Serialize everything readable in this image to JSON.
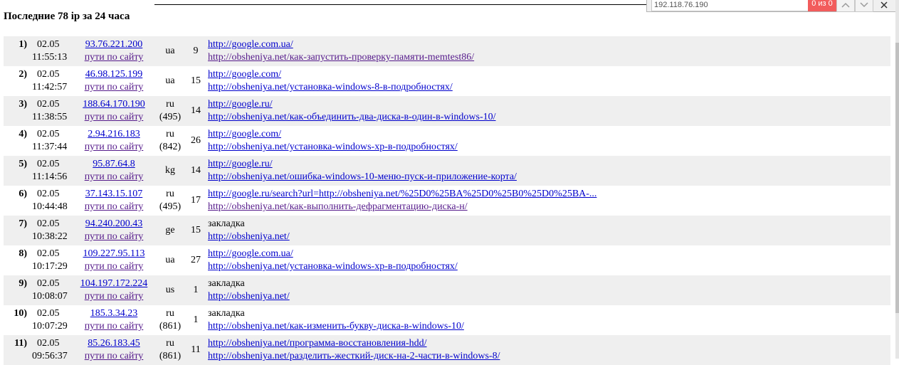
{
  "header": {
    "title": "Последние 78 ip за 24 часа"
  },
  "find_bar": {
    "query": "192.118.76.190",
    "result_count": "0 из 0"
  },
  "rows": [
    {
      "num": "1)",
      "date": "02.05",
      "time": "11:55:13",
      "ip": "93.76.221.200",
      "path_link": "пути по сайту",
      "country": "ua",
      "code": "",
      "count": "9",
      "referrer": "http://google.com.ua/",
      "referrer_is_link": true,
      "page": "http://obsheniya.net/как-запустить-проверку-памяти-memtest86/"
    },
    {
      "num": "2)",
      "date": "02.05",
      "time": "11:42:57",
      "ip": "46.98.125.199",
      "path_link": "пути по сайту",
      "country": "ua",
      "code": "",
      "count": "15",
      "referrer": "http://google.com/",
      "referrer_is_link": true,
      "page": "http://obsheniya.net/установка-windows-8-в-подробностях/"
    },
    {
      "num": "3)",
      "date": "02.05",
      "time": "11:38:55",
      "ip": "188.64.170.190",
      "path_link": "пути по сайту",
      "country": "ru",
      "code": "(495)",
      "count": "14",
      "referrer": "http://google.ru/",
      "referrer_is_link": true,
      "page": "http://obsheniya.net/как-объединить-два-диска-в-один-в-windows-10/"
    },
    {
      "num": "4)",
      "date": "02.05",
      "time": "11:37:44",
      "ip": "2.94.216.183",
      "path_link": "пути по сайту",
      "country": "ru",
      "code": "(842)",
      "count": "26",
      "referrer": "http://google.com/",
      "referrer_is_link": true,
      "page": "http://obsheniya.net/установка-windows-xp-в-подробностях/"
    },
    {
      "num": "5)",
      "date": "02.05",
      "time": "11:14:56",
      "ip": "95.87.64.8",
      "path_link": "пути по сайту",
      "country": "kg",
      "code": "",
      "count": "14",
      "referrer": "http://google.ru/",
      "referrer_is_link": true,
      "page": "http://obsheniya.net/ошибка-windows-10-меню-пуск-и-приложение-корта/"
    },
    {
      "num": "6)",
      "date": "02.05",
      "time": "10:44:48",
      "ip": "37.143.15.107",
      "path_link": "пути по сайту",
      "country": "ru",
      "code": "(495)",
      "count": "17",
      "referrer": "http://google.ru/search?url=http://obsheniya.net/%25D0%25BA%25D0%25B0%25D0%25BA-...",
      "referrer_is_link": true,
      "page": "http://obsheniya.net/как-выполнить-дефрагментацию-диска-н/"
    },
    {
      "num": "7)",
      "date": "02.05",
      "time": "10:38:22",
      "ip": "94.240.200.43",
      "path_link": "пути по сайту",
      "country": "ge",
      "code": "",
      "count": "15",
      "referrer": "закладка",
      "referrer_is_link": false,
      "page": "http://obsheniya.net/"
    },
    {
      "num": "8)",
      "date": "02.05",
      "time": "10:17:29",
      "ip": "109.227.95.113",
      "path_link": "пути по сайту",
      "country": "ua",
      "code": "",
      "count": "27",
      "referrer": "http://google.com.ua/",
      "referrer_is_link": true,
      "page": "http://obsheniya.net/установка-windows-xp-в-подробностях/"
    },
    {
      "num": "9)",
      "date": "02.05",
      "time": "10:08:07",
      "ip": "104.197.172.224",
      "path_link": "пути по сайту",
      "country": "us",
      "code": "",
      "count": "1",
      "referrer": "закладка",
      "referrer_is_link": false,
      "page": "http://obsheniya.net/"
    },
    {
      "num": "10)",
      "date": "02.05",
      "time": "10:07:29",
      "ip": "185.3.34.23",
      "path_link": "пути по сайту",
      "country": "ru",
      "code": "(861)",
      "count": "1",
      "referrer": "закладка",
      "referrer_is_link": false,
      "page": "http://obsheniya.net/как-изменить-букву-диска-в-windows-10/"
    },
    {
      "num": "11)",
      "date": "02.05",
      "time": "09:56:37",
      "ip": "85.26.183.45",
      "path_link": "пути по сайту",
      "country": "ru",
      "code": "(861)",
      "count": "11",
      "referrer": "http://obsheniya.net/программа-восстановления-hdd/",
      "referrer_is_link": true,
      "page": "http://obsheniya.net/разделить-жесткий-диск-на-2-части-в-windows-8/"
    }
  ],
  "colors": {
    "link": "#0000cc",
    "visited_link": "#551a8b",
    "row_shade": "#efefef",
    "find_count_bg": "#f25c5c"
  }
}
